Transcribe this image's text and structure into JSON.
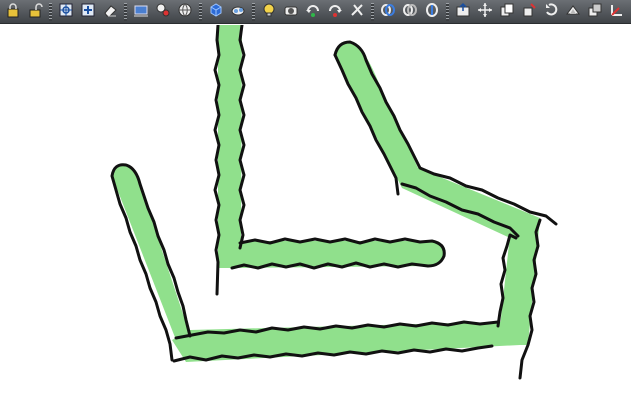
{
  "colors": {
    "toolbar_top": "#6b6f74",
    "toolbar_bottom": "#3f4347",
    "canvas": "#ffffff",
    "path_fill": "#90e08c",
    "outline": "#111111"
  },
  "toolbar": {
    "groups": [
      [
        "lock-icon",
        "open-lock-icon"
      ],
      [
        "target-icon",
        "zoom-box-icon",
        "eraser-icon"
      ],
      [
        "frame-icon",
        "shapes-icon",
        "globe-icon"
      ],
      [
        "wire-cube-icon",
        "eye-icon"
      ],
      [
        "light-bulb-icon",
        "camera-icon",
        "rotate-left-icon",
        "rotate-right-icon",
        "tools-icon"
      ],
      [
        "ring-blue-icon",
        "ring-gray-icon",
        "ring-split-icon"
      ],
      [
        "export-icon",
        "move-icon",
        "copy-icon",
        "transform-icon",
        "rotate-icon",
        "stack-icon",
        "duplicate-icon",
        "axes-icon"
      ]
    ]
  }
}
